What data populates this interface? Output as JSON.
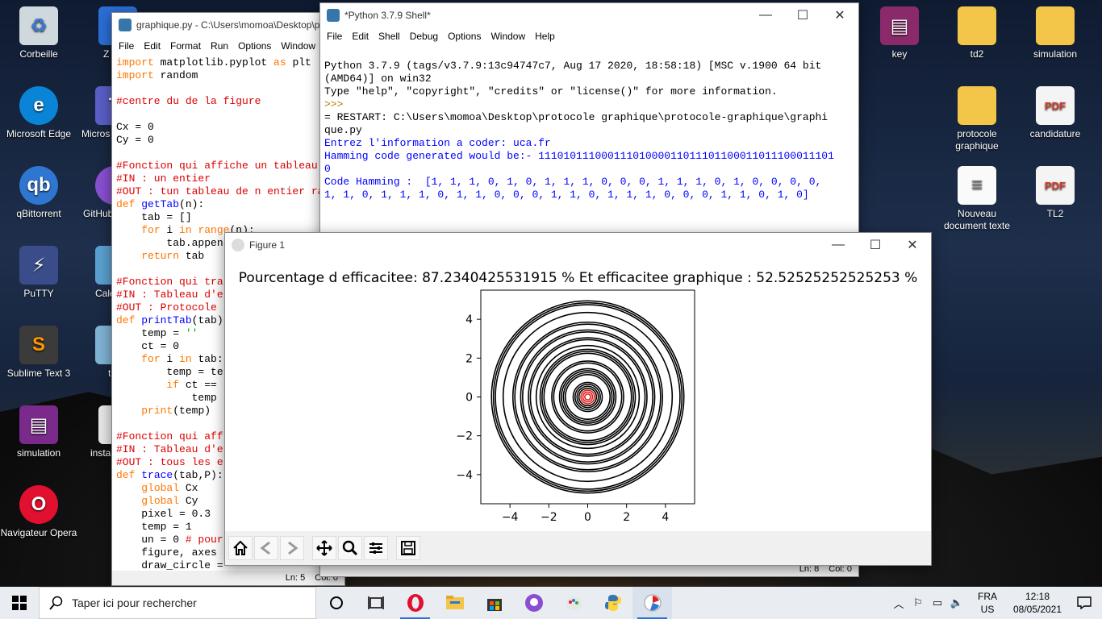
{
  "desktop_icons": [
    {
      "label": "Corbeille",
      "icon": "recycle-bin-icon",
      "color": "#cfd8dc"
    },
    {
      "label": "Microsoft Edge",
      "icon": "edge-icon",
      "color": "#0a84d6"
    },
    {
      "label": "qBittorrent",
      "icon": "qbittorrent-icon",
      "color": "#2f76d1"
    },
    {
      "label": "PuTTY",
      "icon": "putty-icon",
      "color": "#3a4d8a"
    },
    {
      "label": "Sublime Text 3",
      "icon": "sublime-icon",
      "color": "#ff9800"
    },
    {
      "label": "simulation",
      "icon": "winrar-icon",
      "color": "#7a2a8a"
    },
    {
      "label": "Navigateur Opera",
      "icon": "opera-icon",
      "color": "#e0102e"
    }
  ],
  "desktop_icons_col2": [
    {
      "label": "Z",
      "icon": "app-icon"
    },
    {
      "label": "Micros",
      "icon": "teams-icon"
    },
    {
      "label": "GitHub",
      "icon": "github-icon"
    },
    {
      "label": "Calc",
      "icon": "calc-icon"
    },
    {
      "label": "t",
      "icon": "t-icon"
    },
    {
      "label": "insta",
      "icon": "install-icon"
    }
  ],
  "desktop_icons_right": [
    {
      "label": "key",
      "icon": "winrar-icon"
    },
    {
      "label": "td2",
      "icon": "folder-icon"
    },
    {
      "label": "simulation",
      "icon": "folder-icon"
    },
    {
      "label": "protocole graphique",
      "icon": "folder-icon"
    },
    {
      "label": "candidature",
      "icon": "pdf-icon"
    },
    {
      "label": "Nouveau document texte",
      "icon": "text-file-icon"
    },
    {
      "label": "TL2",
      "icon": "pdf-icon"
    }
  ],
  "editor": {
    "title": "graphique.py - C:\\Users\\momoa\\Desktop\\p",
    "menu": [
      "File",
      "Edit",
      "Format",
      "Run",
      "Options",
      "Window"
    ],
    "status": {
      "ln": "Ln: 5",
      "col": "Col: 0"
    }
  },
  "shell": {
    "title": "*Python 3.7.9 Shell*",
    "menu": [
      "File",
      "Edit",
      "Shell",
      "Debug",
      "Options",
      "Window",
      "Help"
    ],
    "lines": [
      {
        "text": "Python 3.7.9 (tags/v3.7.9:13c94747c7, Aug 17 2020, 18:58:18) [MSC v.1900 64 bit",
        "cls": ""
      },
      {
        "text": "(AMD64)] on win32",
        "cls": ""
      },
      {
        "text": "Type \"help\", \"copyright\", \"credits\" or \"license()\" for more information.",
        "cls": ""
      },
      {
        "text": ">>> ",
        "cls": "prompt"
      },
      {
        "text": "= RESTART: C:\\Users\\momoa\\Desktop\\protocole graphique\\protocole-graphique\\graphi",
        "cls": ""
      },
      {
        "text": "que.py",
        "cls": ""
      },
      {
        "text": "Entrez l'information a coder: uca.fr",
        "cls": "blue"
      },
      {
        "text": "Hamming code generated would be:- 11101011100011101000011011101100011011100011101",
        "cls": "blue"
      },
      {
        "text": "0",
        "cls": "blue"
      },
      {
        "text": "Code Hamming :  [1, 1, 1, 0, 1, 0, 1, 1, 1, 0, 0, 0, 1, 1, 1, 0, 1, 0, 0, 0, 0,",
        "cls": "blue"
      },
      {
        "text": "1, 1, 0, 1, 1, 1, 0, 1, 1, 0, 0, 0, 1, 1, 0, 1, 1, 1, 0, 0, 0, 1, 1, 0, 1, 0]",
        "cls": "blue"
      }
    ],
    "status": {
      "ln": "Ln: 8",
      "col": "Col: 0"
    }
  },
  "figure": {
    "title": "Figure 1",
    "plot_title": "Pourcentage d efficacitee: 87.2340425531915 % Et efficacitee graphique : 52.52525252525253 %"
  },
  "chart_data": {
    "type": "scatter",
    "title": "Pourcentage d efficacitee: 87.2340425531915 % Et efficacitee graphique : 52.52525252525253 %",
    "xlabel": "",
    "ylabel": "",
    "xlim": [
      -5.5,
      5.5
    ],
    "ylim": [
      -5.5,
      5.5
    ],
    "x_ticks": [
      "−4",
      "−2",
      "0",
      "2",
      "4"
    ],
    "y_ticks": [
      "4",
      "2",
      "0",
      "−2",
      "−4"
    ],
    "x_tick_values": [
      -4,
      -2,
      0,
      2,
      4
    ],
    "y_tick_values": [
      4,
      2,
      0,
      -2,
      -4
    ],
    "circles_black_radii": [
      0.45,
      0.55,
      0.65,
      0.75,
      1.15,
      1.25,
      1.35,
      1.45,
      1.75,
      1.85,
      2.25,
      2.35,
      2.45,
      2.65,
      2.95,
      3.05,
      3.35,
      3.45,
      3.75,
      3.85,
      4.35,
      4.75,
      4.85,
      4.95
    ],
    "circles_red_radii": [
      0.15,
      0.25,
      0.35
    ],
    "colors": {
      "line": "#000000",
      "highlight": "#e02020"
    }
  },
  "taskbar": {
    "search_placeholder": "Taper ici pour rechercher",
    "lang_top": "FRA",
    "lang_bottom": "US",
    "time": "12:18",
    "date": "08/05/2021"
  }
}
